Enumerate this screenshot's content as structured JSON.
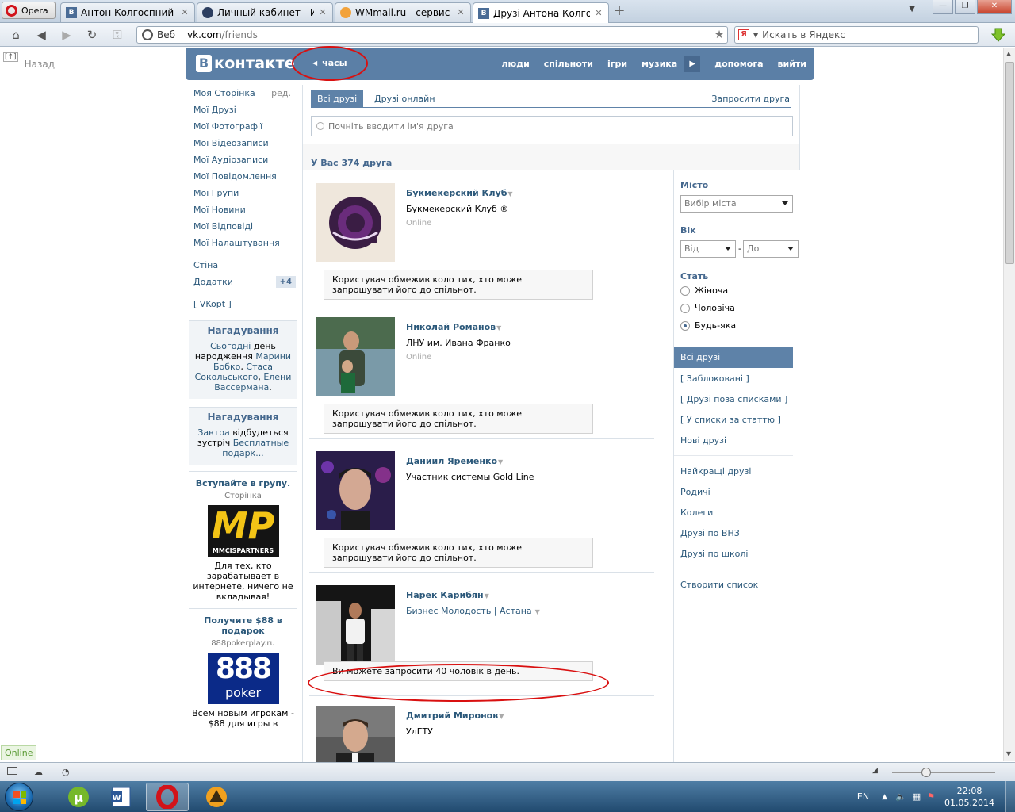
{
  "browser": {
    "menu_label": "Opera",
    "tabs": [
      {
        "title": "Антон Колгоспний",
        "favicon": "vk"
      },
      {
        "title": "Личный кабинет - Ис...",
        "favicon": "opera"
      },
      {
        "title": "WMmail.ru - сервис п...",
        "favicon": "wmmail"
      },
      {
        "title": "Друзі Антона Колгосп...",
        "favicon": "vk",
        "active": true
      }
    ],
    "address": {
      "web_label": "Веб",
      "host": "vk.com",
      "path": "/friends"
    },
    "search_placeholder": "Искать в Яндекс",
    "back_label": "Назад"
  },
  "vk": {
    "logo_text": "контакте",
    "logo_badge": "В",
    "clock_label": "часы",
    "nav": [
      "люди",
      "спільноти",
      "ігри",
      "музика",
      "допомога",
      "вийти"
    ],
    "sidebar": {
      "items": [
        "Моя Сторінка",
        "Мої Друзі",
        "Мої Фотографії",
        "Мої Відеозаписи",
        "Мої Аудіозаписи",
        "Мої Повідомлення",
        "Мої Групи",
        "Мої Новини",
        "Мої Відповіді",
        "Мої Налаштування"
      ],
      "edit_label": "ред.",
      "items2": [
        "Стіна",
        "Додатки"
      ],
      "apps_count": "+4",
      "vkopt": "[ VKopt ]",
      "reminder1": {
        "title": "Нагадування",
        "today": "Сьогодні",
        "t1": " день народження ",
        "n1": "Марини Бобко",
        "comma": ", ",
        "n2": "Стаса Сокольського",
        "t2": ", ",
        "n3": "Елени Вассермана",
        "dot": "."
      },
      "reminder2": {
        "title": "Нагадування",
        "tomorrow": "Завтра",
        "t1": " відбудеться зустріч ",
        "link": "Бесплатные подарк..."
      },
      "ad1": {
        "title": "Вступайте в групу.",
        "sub": "Сторінка",
        "img_text": "MP",
        "img_sub": "MMCISPARTNERS",
        "text": "Для тех, кто зарабатывает в интернете, ничего не вкладывая!"
      },
      "ad2": {
        "title": "Получите $88 в подарок",
        "sub": "888pokerplay.ru",
        "img_n": "888",
        "img_w": "poker",
        "text": "Всем новым игрокам - $88 для игры в"
      }
    },
    "main": {
      "tabs": [
        "Всі друзі",
        "Друзі онлайн"
      ],
      "invite": "Запросити друга",
      "search_placeholder": "Почніть вводити ім'я друга",
      "summary": "У Вас 374 друга",
      "friends": [
        {
          "name": "Букмекерский Клуб",
          "info": "Букмекерский Клуб ®",
          "status": "Online",
          "note": "Користувач обмежив коло тих, хто може запрошувати його до спільнот."
        },
        {
          "name": "Николай Романов",
          "info": "ЛНУ им. Ивана Франко",
          "status": "Online",
          "note": "Користувач обмежив коло тих, хто може запрошувати його до спільнот."
        },
        {
          "name": "Даниил Яременко",
          "info": "Участник системы Gold Line",
          "status": "",
          "note": "Користувач обмежив коло тих, хто може запрошувати його до спільнот."
        },
        {
          "name": "Нарек Карибян",
          "info": "Бизнес Молодость | Астана",
          "status": "",
          "note": "Ви можете запросити 40 чоловік в день."
        },
        {
          "name": "Дмитрий Миронов",
          "info": "УлГТУ",
          "status": "",
          "note": ""
        }
      ]
    },
    "filter": {
      "city_label": "Місто",
      "city_value": "Вибір міста",
      "age_label": "Вік",
      "age_from": "Від",
      "age_dash": "-",
      "age_to": "До",
      "sex_label": "Стать",
      "sex_options": [
        "Жіноча",
        "Чоловіча",
        "Будь-яка"
      ],
      "sex_selected": 2,
      "lists1": [
        "Всі друзі",
        "[ Заблоковані ]",
        "[ Друзі поза списками ]",
        "[ У списки за статтю ]",
        "Нові друзі"
      ],
      "lists2": [
        "Найкращі друзі",
        "Родичі",
        "Колеги",
        "Друзі по ВНЗ",
        "Друзі по школі"
      ],
      "create": "Створити список"
    }
  },
  "statusbar": {
    "online_badge": "Online"
  },
  "taskbar": {
    "lang": "EN",
    "time": "22:08",
    "date": "01.05.2014"
  },
  "colors": {
    "vk_header": "#5b7fa6",
    "vk_link": "#2b587a",
    "annotation_red": "#d91010"
  }
}
